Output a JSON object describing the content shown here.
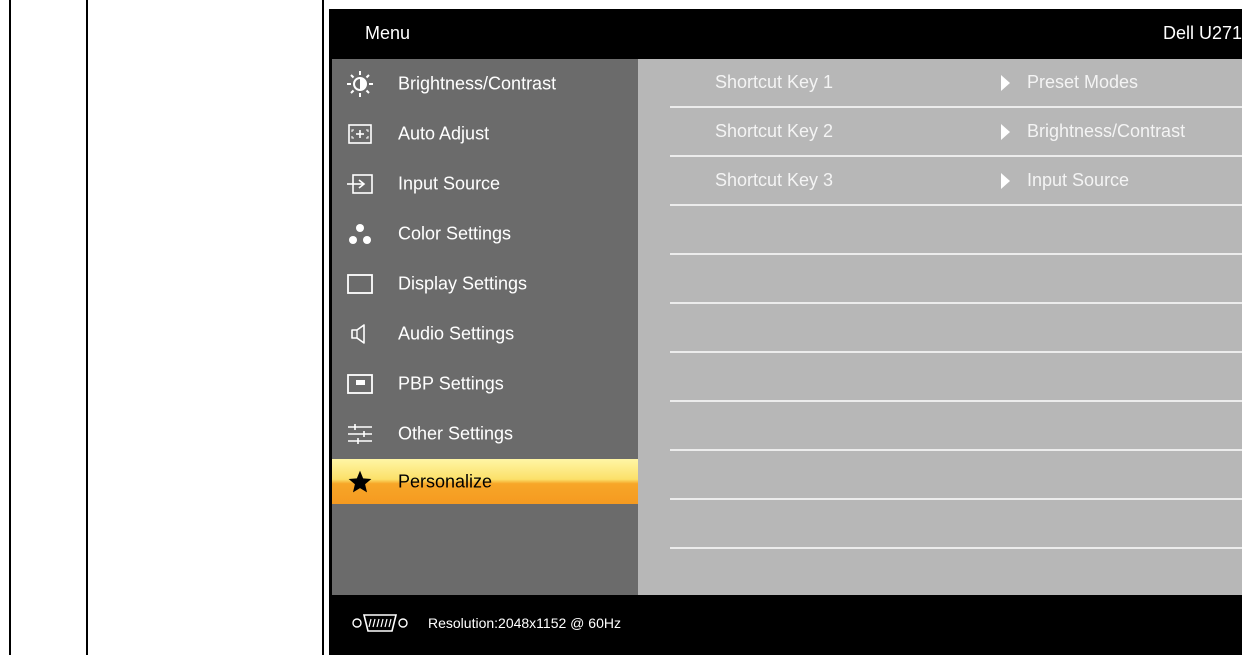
{
  "osd": {
    "title": "Menu",
    "model": "Dell U271",
    "menu_items": [
      {
        "label": "Brightness/Contrast",
        "icon": "brightness-icon",
        "selected": false
      },
      {
        "label": "Auto Adjust",
        "icon": "auto-adjust-icon",
        "selected": false
      },
      {
        "label": "Input Source",
        "icon": "input-source-icon",
        "selected": false
      },
      {
        "label": "Color Settings",
        "icon": "color-settings-icon",
        "selected": false
      },
      {
        "label": "Display Settings",
        "icon": "display-settings-icon",
        "selected": false
      },
      {
        "label": "Audio Settings",
        "icon": "audio-settings-icon",
        "selected": false
      },
      {
        "label": "PBP Settings",
        "icon": "pbp-settings-icon",
        "selected": false
      },
      {
        "label": "Other Settings",
        "icon": "other-settings-icon",
        "selected": false
      },
      {
        "label": "Personalize",
        "icon": "star-icon",
        "selected": true
      }
    ],
    "settings": [
      {
        "label": "Shortcut Key 1",
        "value": "Preset Modes"
      },
      {
        "label": "Shortcut Key 2",
        "value": "Brightness/Contrast"
      },
      {
        "label": "Shortcut Key 3",
        "value": "Input Source"
      },
      {
        "label": "",
        "value": ""
      },
      {
        "label": "",
        "value": ""
      },
      {
        "label": "",
        "value": ""
      },
      {
        "label": "",
        "value": ""
      },
      {
        "label": "",
        "value": ""
      },
      {
        "label": "",
        "value": ""
      },
      {
        "label": "",
        "value": ""
      }
    ],
    "footer": {
      "connector_icon": "vga-connector-icon",
      "resolution": "Resolution:2048x1152 @ 60Hz"
    }
  }
}
